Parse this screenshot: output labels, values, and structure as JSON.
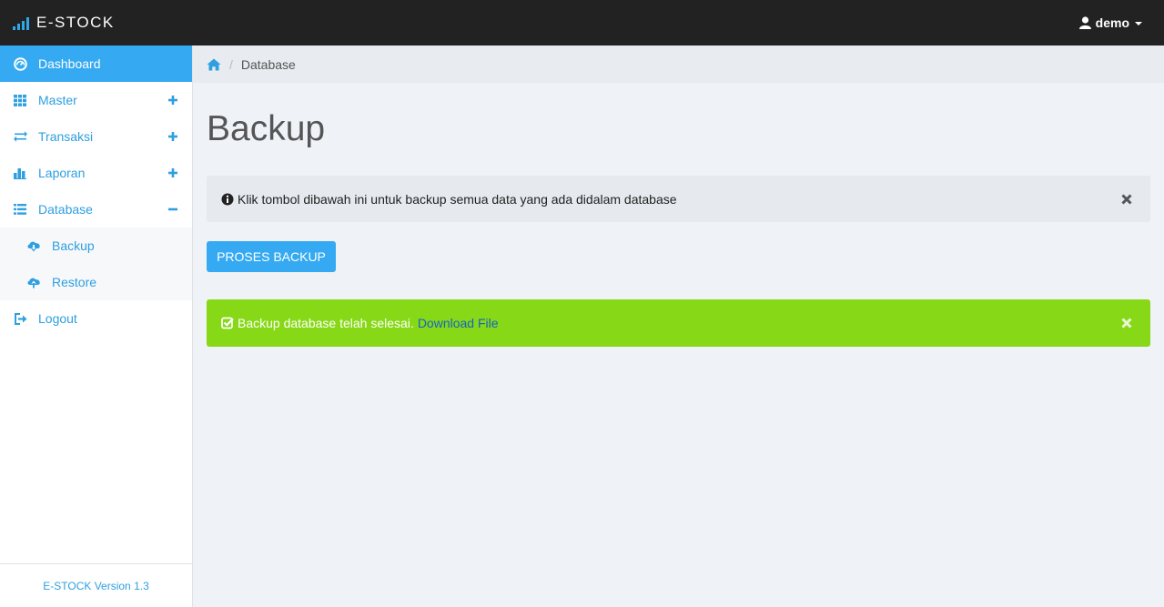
{
  "brand": {
    "name": "E-STOCK"
  },
  "user": {
    "name": "demo"
  },
  "sidebar": {
    "items": [
      {
        "label": "Dashboard",
        "icon": "dashboard-icon",
        "active": true
      },
      {
        "label": "Master",
        "icon": "grid-icon",
        "toggle": "+"
      },
      {
        "label": "Transaksi",
        "icon": "exchange-icon",
        "toggle": "+"
      },
      {
        "label": "Laporan",
        "icon": "bar-chart-icon",
        "toggle": "+"
      },
      {
        "label": "Database",
        "icon": "list-icon",
        "toggle": "-"
      }
    ],
    "submenu": [
      {
        "label": "Backup",
        "icon": "cloud-download-icon"
      },
      {
        "label": "Restore",
        "icon": "cloud-upload-icon"
      }
    ],
    "logout": {
      "label": "Logout",
      "icon": "logout-icon"
    },
    "footer": "E-STOCK Version 1.3"
  },
  "breadcrumb": {
    "current": "Database"
  },
  "main": {
    "title": "Backup",
    "info_message": "Klik tombol dibawah ini untuk backup semua data yang ada didalam database",
    "button_label": "PROSES BACKUP",
    "success_message": "Backup database telah selesai.",
    "success_link": "Download File"
  },
  "colors": {
    "accent": "#35aaf2",
    "success": "#87d817",
    "navbar": "#222222",
    "link": "#2e9fe0"
  }
}
